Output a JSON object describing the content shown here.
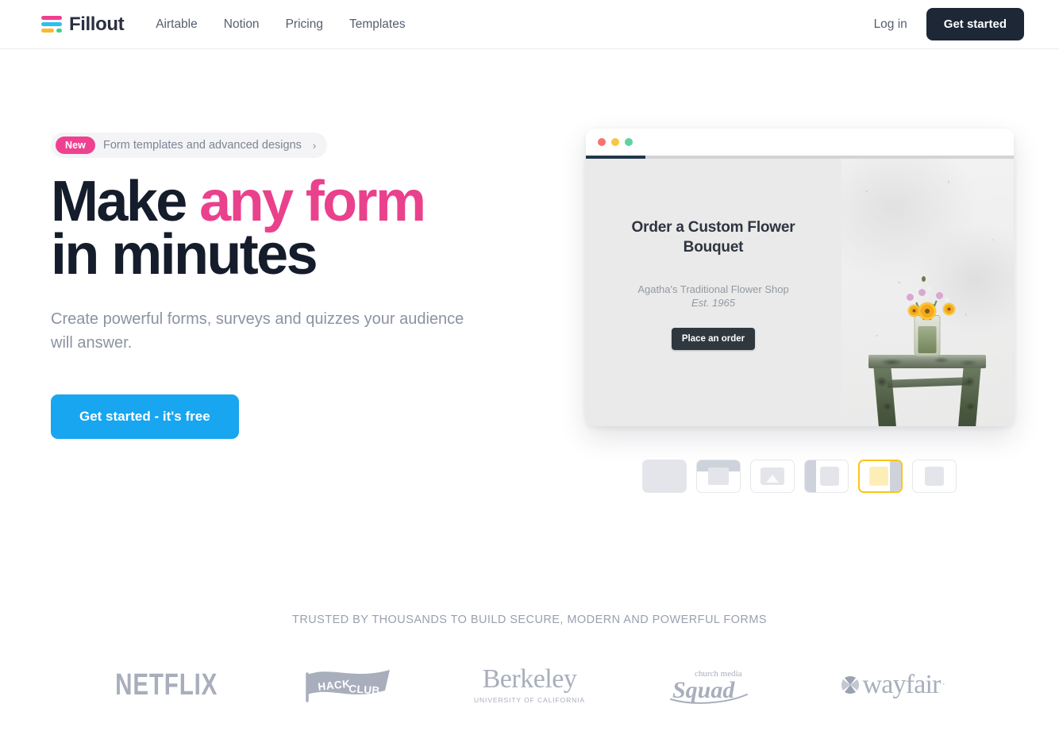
{
  "header": {
    "brand": "Fillout",
    "logo_colors": {
      "pink": "#ef3f8f",
      "blue": "#2fbdf2",
      "yellow": "#fcb832",
      "green": "#3ed28a"
    },
    "nav": [
      {
        "label": "Airtable"
      },
      {
        "label": "Notion"
      },
      {
        "label": "Pricing"
      },
      {
        "label": "Templates"
      }
    ],
    "login_label": "Log in",
    "get_started_label": "Get started"
  },
  "hero": {
    "badge": {
      "tag": "New",
      "text": "Form templates and advanced designs",
      "chevron": "›",
      "tag_color": "#ee4291"
    },
    "headline_line1_plain": "Make ",
    "headline_line1_accent": "any form",
    "headline_line2": "in minutes",
    "accent_color": "#ea418d",
    "subhead": "Create powerful forms, surveys and quizzes your audience will answer.",
    "cta_label": "Get started - it's free",
    "cta_color": "#17a6ef"
  },
  "mockup": {
    "traffic_lights": [
      "#f9726d",
      "#f8c546",
      "#5fd39b"
    ],
    "progress_percent": 14,
    "progress_fill_color": "#21374a",
    "form": {
      "title": "Order a Custom Flower Bouquet",
      "shop_name": "Agatha's Traditional Flower Shop",
      "established": "Est. 1965",
      "button_label": "Place an order"
    },
    "photo_alt": "Sunflowers in a glass jar on a weathered green stool against a white wall"
  },
  "layout_picker": {
    "selected_index": 4,
    "selected_border_color": "#fcc419",
    "options": [
      {
        "name": "full-bleed"
      },
      {
        "name": "top-band-card"
      },
      {
        "name": "image-centered"
      },
      {
        "name": "left-split"
      },
      {
        "name": "right-split-highlighted"
      },
      {
        "name": "centered-card"
      }
    ]
  },
  "trusted": {
    "title": "TRUSTED BY THOUSANDS TO BUILD SECURE, MODERN AND POWERFUL FORMS",
    "logos": [
      {
        "name": "netflix",
        "text": "NETFLIX"
      },
      {
        "name": "hack-club",
        "text": "HACK CLUB"
      },
      {
        "name": "berkeley",
        "text": "Berkeley",
        "subtext": "UNIVERSITY OF CALIFORNIA"
      },
      {
        "name": "church-media-squad",
        "text": "Squad",
        "subtext": "church media"
      },
      {
        "name": "wayfair",
        "text": "wayfair"
      }
    ]
  }
}
